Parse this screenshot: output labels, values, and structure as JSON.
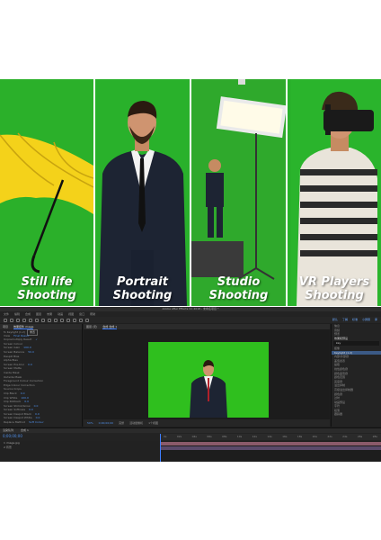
{
  "panels": [
    {
      "line1": "Still life",
      "line2": "Shooting",
      "bg": "#2bb02a"
    },
    {
      "line1": "Portrait",
      "line2": "Shooting",
      "bg": "#29b12b"
    },
    {
      "line1": "Studio",
      "line2": "Shooting",
      "bg": "#2fa92c"
    },
    {
      "line1": "VR Players",
      "line2": "Shooting",
      "bg": "#2ab42c"
    }
  ],
  "ae": {
    "title": "Adobe After Effects CC 2018 - 未命名项目 *",
    "menu": [
      "文件",
      "编辑",
      "合成",
      "图层",
      "效果",
      "动画",
      "视图",
      "窗口",
      "帮助"
    ],
    "workspace": [
      "默认",
      "了解",
      "标准",
      "小屏幕",
      "库"
    ],
    "left_panel": {
      "tabs": [
        "项目",
        "效果控件 image"
      ],
      "section": "Keylight (1.2)",
      "rows": [
        {
          "label": "fx Keylight (1.2)",
          "value": "重置"
        },
        {
          "label": "View",
          "value": "Final Result"
        },
        {
          "label": "Unpremultiply Result",
          "value": "✓"
        },
        {
          "label": "Screen Colour",
          "value": ""
        },
        {
          "label": "Screen Gain",
          "value": "100.0"
        },
        {
          "label": "Screen Balance",
          "value": "50.0"
        },
        {
          "label": "Despill Bias",
          "value": ""
        },
        {
          "label": "Alpha Bias",
          "value": ""
        },
        {
          "label": "Screen Pre-blur",
          "value": "0.0"
        },
        {
          "label": "Screen Matte",
          "value": ""
        },
        {
          "label": "Inside Mask",
          "value": ""
        },
        {
          "label": "Outside Mask",
          "value": ""
        },
        {
          "label": "Foreground Colour Correction",
          "value": ""
        },
        {
          "label": "Edge Colour Correction",
          "value": ""
        },
        {
          "label": "Source Crops",
          "value": ""
        },
        {
          "label": "Clip Black",
          "value": "0.0"
        },
        {
          "label": "Clip White",
          "value": "100.0"
        },
        {
          "label": "Clip Rollback",
          "value": "0.0"
        },
        {
          "label": "Screen Shrink/Grow",
          "value": "0.0"
        },
        {
          "label": "Screen Softness",
          "value": "0.0"
        },
        {
          "label": "Screen Despot Black",
          "value": "0.0"
        },
        {
          "label": "Screen Despot White",
          "value": "0.0"
        },
        {
          "label": "Replace Method",
          "value": "Soft Colour"
        }
      ],
      "buttons": [
        "Reset",
        "About"
      ]
    },
    "center_panel": {
      "tabs": [
        "图层 (无)",
        "合成 合成 1"
      ],
      "controls": [
        "50%",
        "0;00;00;00",
        "完整",
        "活动摄像机",
        "1个视图"
      ]
    },
    "right_panel": {
      "tabs": [
        "信息",
        "音频",
        "预览",
        "效果和预设",
        "字符",
        "段落",
        "跟踪器"
      ],
      "search": "key",
      "items": [
        "抠像",
        "Keylight (1.2)",
        "内部/外部键",
        "差值遮罩",
        "提取",
        "线性颜色键",
        "颜色差值键",
        "颜色范围",
        "亮度键",
        "溢出抑制",
        "高级溢出抑制器",
        "颜色键",
        "过时",
        "动画预设"
      ],
      "selected_index": 1
    },
    "timeline": {
      "tabs": [
        "渲染队列",
        "合成 1"
      ],
      "timecode": "0;00;00;00",
      "ruler": [
        "0s",
        "02s",
        "04s",
        "06s",
        "08s",
        "10s",
        "12s",
        "14s",
        "16s",
        "18s",
        "20s",
        "22s",
        "24s",
        "26s",
        "28s"
      ],
      "layers": [
        "1  image.jpg",
        "2  背景"
      ]
    }
  }
}
